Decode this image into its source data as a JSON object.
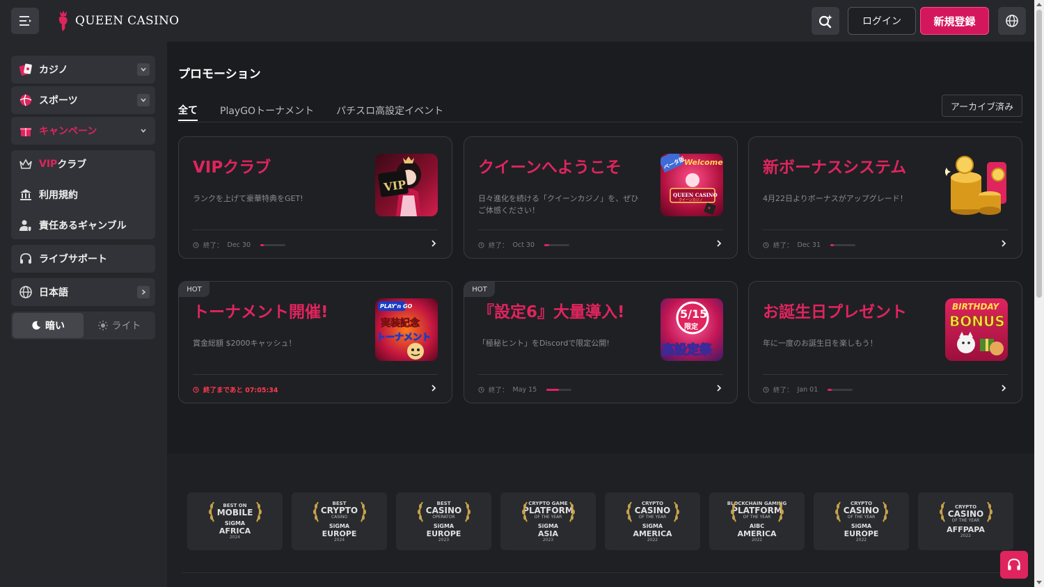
{
  "header": {
    "logo_text": "QUEEN CASINO",
    "login_label": "ログイン",
    "register_label": "新規登録"
  },
  "sidebar": {
    "casino": "カジノ",
    "sports": "スポーツ",
    "campaign": "キャンペーン",
    "vip_prefix": "VIP",
    "vip_suffix": " クラブ",
    "terms": "利用規約",
    "responsible": "責任あるギャンブル",
    "live_support": "ライブサポート",
    "language": "日本語",
    "theme_dark": "暗い",
    "theme_light": "ライト"
  },
  "page": {
    "title": "プロモーション",
    "tabs": [
      "全て",
      "PlayGOトーナメント",
      "パチスロ高設定イベント"
    ],
    "archive_label": "アーカイブ済み"
  },
  "cards": [
    {
      "title": "VIPクラブ",
      "desc": "ランクを上げて豪華特典をGET!",
      "foot": "終了：",
      "date": "Dec 30",
      "progress": 0.15
    },
    {
      "title": "クイーンへようこそ",
      "desc": "日々進化を続ける「クイーンカジノ」を、ぜひご体感ください！",
      "foot": "終了：",
      "date": "Oct 30",
      "progress": 0.2
    },
    {
      "title": "新ボーナスシステム",
      "desc": "4月22日よりボーナスがアップグレード！",
      "foot": "終了：",
      "date": "Dec 31",
      "progress": 0.15
    },
    {
      "title": "トーナメント開催!",
      "desc": "賞金総額 $2000キャッシュ！",
      "foot": "終了まであと 07:05:34",
      "hot": "HOT"
    },
    {
      "title": "『設定6』大量導入!",
      "desc": "「極秘ヒント」をDiscordで限定公開!",
      "foot": "終了：",
      "date": "May 15",
      "progress": 0.5,
      "hot": "HOT"
    },
    {
      "title": "お誕生日プレゼント",
      "desc": "年に一度のお誕生日を楽しもう！",
      "foot": "終了：",
      "date": "Jan 01",
      "progress": 0.15
    }
  ],
  "thumbs": {
    "vip": "VIP",
    "welcome_badge": "ベータ版",
    "welcome_sign": "Welcome to",
    "welcome_brand": "QUEEN CASINO",
    "welcome_sub": "クイーンカジノ",
    "playn_brand": "PLAY'n GO",
    "playn_line1": "実装記念",
    "playn_line2": "トーナメント",
    "setting_date": "5/15",
    "setting_limited": "限定",
    "setting_fest": "高設定祭",
    "birthday_line1": "BIRTHDAY",
    "birthday_line2": "BONUS"
  },
  "awards": [
    {
      "l1": "BEST ON",
      "l2": "MOBILE",
      "l3": "",
      "org": "SiGMA",
      "region": "AFRICA",
      "year": "2024"
    },
    {
      "l1": "BEST",
      "l2": "CRYPTO",
      "l3": "CASINO",
      "org": "SiGMA",
      "region": "EUROPE",
      "year": "2024"
    },
    {
      "l1": "BEST",
      "l2": "CASINO",
      "l3": "OPERATOR",
      "org": "SiGMA",
      "region": "EUROPE",
      "year": "2023"
    },
    {
      "l1": "CRYPTO GAME",
      "l2": "PLATFORM",
      "l3": "OF THE YEAR",
      "org": "SiGMA",
      "region": "ASIA",
      "year": "2023"
    },
    {
      "l1": "CRYPTO",
      "l2": "CASINO",
      "l3": "OF THE YEAR",
      "org": "SiGMA",
      "region": "AMERICA",
      "year": "2022"
    },
    {
      "l1": "BLOCKCHAIN GAMING",
      "l2": "PLATFORM",
      "l3": "OF THE YEAR",
      "org": "AIBC",
      "region": "AMERICA",
      "year": "2022"
    },
    {
      "l1": "CRYPTO",
      "l2": "CASINO",
      "l3": "OF THE YEAR",
      "org": "SiGMA",
      "region": "EUROPE",
      "year": "2022"
    },
    {
      "l1": "CRYPTO",
      "l2": "CASINO",
      "l3": "OF THE YEAR",
      "org": "",
      "region": "AFFPAPA",
      "year": "2022"
    }
  ],
  "colors": {
    "accent": "#e0245e",
    "bg": "#1b1c1f",
    "panel": "#26272b"
  }
}
